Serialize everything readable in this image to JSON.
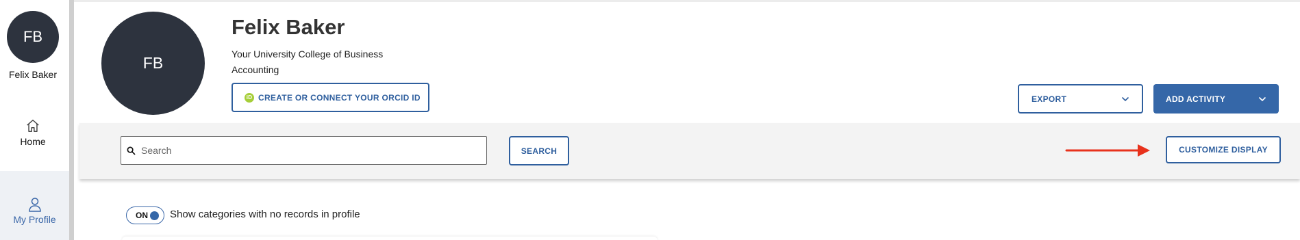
{
  "sidebar": {
    "avatar_initials": "FB",
    "user_name": "Felix Baker",
    "home_label": "Home",
    "profile_label": "My Profile"
  },
  "profile": {
    "avatar_initials": "FB",
    "name": "Felix Baker",
    "org_line1": "Your University College of Business",
    "org_line2": "Accounting",
    "orcid_icon_text": "iD",
    "orcid_button": "CREATE OR CONNECT YOUR ORCID ID"
  },
  "actions": {
    "export_label": "EXPORT",
    "add_activity_label": "ADD ACTIVITY"
  },
  "toolbar": {
    "search_placeholder": "Search",
    "search_value": "",
    "search_button": "SEARCH",
    "customize_button": "CUSTOMIZE DISPLAY"
  },
  "toggle": {
    "state_label": "ON",
    "description": "Show categories with no records in profile"
  },
  "colors": {
    "accent": "#3567a8",
    "avatar_bg": "#2d333e",
    "annotation_arrow": "#e8321c"
  }
}
